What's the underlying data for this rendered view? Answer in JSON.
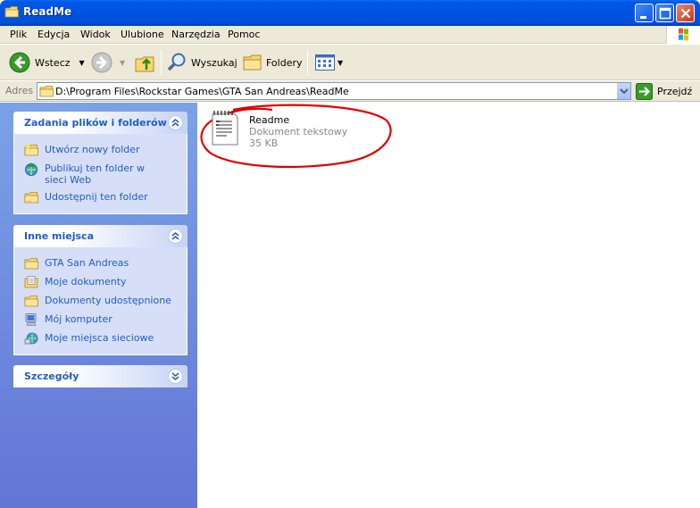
{
  "window": {
    "title": "ReadMe",
    "controls": [
      "minimize-button",
      "maximize-button",
      "close-button"
    ]
  },
  "menubar": {
    "items": [
      "Plik",
      "Edycja",
      "Widok",
      "Ulubione",
      "Narzędzia",
      "Pomoc"
    ]
  },
  "toolbar": {
    "back_label": "Wstecz",
    "search_label": "Wyszukaj",
    "folders_label": "Foldery"
  },
  "address": {
    "label": "Adres",
    "value": "D:\\Program Files\\Rockstar Games\\GTA San Andreas\\ReadMe",
    "go_label": "Przejdź"
  },
  "taskpane": {
    "file_tasks": {
      "title": "Zadania plików i folderów",
      "items": [
        {
          "label": "Utwórz nowy folder",
          "icon": "new-folder-icon"
        },
        {
          "label": "Publikuj ten folder w sieci Web",
          "icon": "publish-web-icon"
        },
        {
          "label": "Udostępnij ten folder",
          "icon": "share-folder-icon"
        }
      ]
    },
    "other_places": {
      "title": "Inne miejsca",
      "items": [
        {
          "label": "GTA San Andreas",
          "icon": "folder-icon"
        },
        {
          "label": "Moje dokumenty",
          "icon": "my-documents-icon"
        },
        {
          "label": "Dokumenty udostępnione",
          "icon": "shared-documents-icon"
        },
        {
          "label": "Mój komputer",
          "icon": "my-computer-icon"
        },
        {
          "label": "Moje miejsca sieciowe",
          "icon": "network-places-icon"
        }
      ]
    },
    "details": {
      "title": "Szczegóły"
    }
  },
  "content": {
    "files": [
      {
        "name": "Readme",
        "type": "Dokument tekstowy",
        "size": "35 KB",
        "icon": "text-document-icon"
      }
    ],
    "annotation_color": "#e00000"
  },
  "colors": {
    "titlebar": "#0054e3",
    "taskpane_top": "#7ba2e7",
    "taskpane_bottom": "#6375d6",
    "task_link": "#215dc6",
    "chrome": "#ece9d8"
  }
}
